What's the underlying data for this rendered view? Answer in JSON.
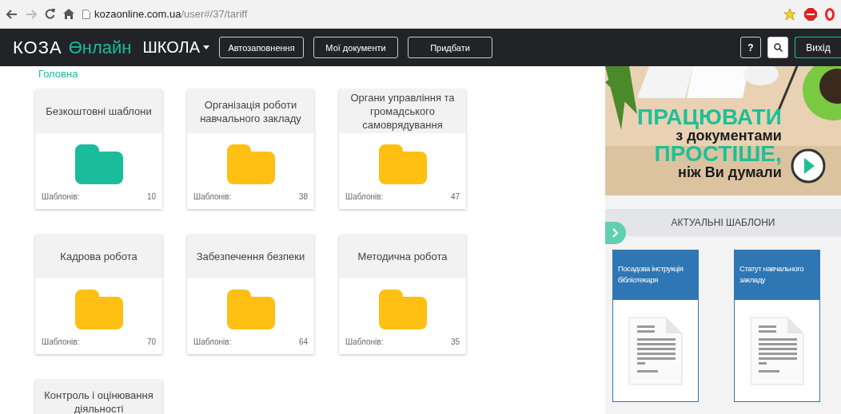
{
  "browser": {
    "url_host": "kozaonline.com.ua",
    "url_path": "/user#/37/tariff"
  },
  "navbar": {
    "logo_main": "КОЗА",
    "logo_accent": "Өнлайн",
    "section": "ШКОЛА",
    "buttons": [
      "Автозаповнення",
      "Мої документи",
      "Придбати"
    ],
    "help": "?",
    "logout": "Вихід"
  },
  "breadcrumb": "Головна",
  "folders": [
    {
      "title": "Безкоштовні шаблони",
      "count_label": "Шаблонів:",
      "count": "10",
      "color": "#1abc9c"
    },
    {
      "title": "Організація роботи навчального закладу",
      "count_label": "Шаблонів:",
      "count": "38",
      "color": "#ffbf13"
    },
    {
      "title": "Органи управління та громадського самоврядування",
      "count_label": "Шаблонів:",
      "count": "47",
      "color": "#ffbf13"
    },
    {
      "title": "Кадрова робота",
      "count_label": "Шаблонів:",
      "count": "70",
      "color": "#ffbf13"
    },
    {
      "title": "Забезпечення безпеки",
      "count_label": "Шаблонів:",
      "count": "64",
      "color": "#ffbf13"
    },
    {
      "title": "Методична робота",
      "count_label": "Шаблонів:",
      "count": "35",
      "color": "#ffbf13"
    },
    {
      "title": "Контроль і оцінювання діяльності"
    }
  ],
  "banner": {
    "line_1": "ПРАЦЮВАТИ",
    "line_2": "з документами",
    "line_3": "ПРОСТІШЕ,",
    "line_4": "ніж Ви думали"
  },
  "templates": {
    "title": "АКТУАЛЬНІ ШАБЛОНИ",
    "items": [
      "Посадова інструкція бібліотекаря",
      "Статут навчального закладу"
    ]
  }
}
